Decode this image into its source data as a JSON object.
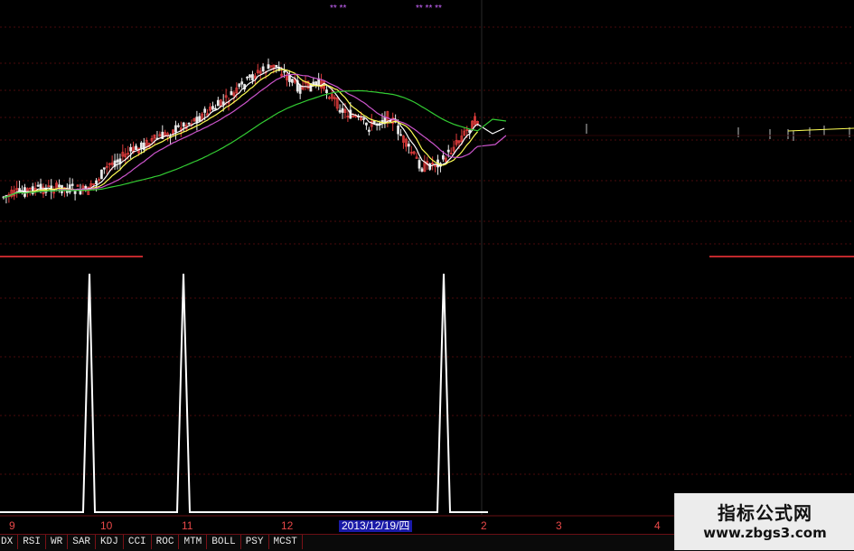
{
  "chart_data": [
    {
      "type": "candlestick",
      "panel": "price",
      "grid": true,
      "moving_averages": [
        {
          "color": "#ffffff"
        },
        {
          "color": "#ffff55"
        },
        {
          "color": "#cc55cc"
        },
        {
          "color": "#33cc33"
        }
      ]
    },
    {
      "type": "line",
      "panel": "indicator",
      "grid": true,
      "signal_indices": [
        31,
        64,
        157
      ],
      "line_color": "#ffffff"
    }
  ],
  "colors": {
    "background": "#000000",
    "grid": "#4a0a0c",
    "up_candle": "#e03c3c",
    "down_candle": "#e8e8e8",
    "ma5": "#ffffff",
    "ma10": "#ffff55",
    "ma20": "#cc55cc",
    "ma60": "#33cc33",
    "separator": "#c0282c",
    "axis_text": "#e84848"
  },
  "top_markers": {
    "left": "** **",
    "right": "** ** **"
  },
  "time_axis": {
    "labels": [
      "9",
      "10",
      "11",
      "12",
      "2",
      "3",
      "4"
    ],
    "crosshair_date": "2013/12/19/四"
  },
  "indicator_tabs": [
    "DX",
    "RSI",
    "WR",
    "SAR",
    "KDJ",
    "CCI",
    "ROC",
    "MTM",
    "BOLL",
    "PSY",
    "MCST"
  ],
  "watermark": {
    "title": "指标公式网",
    "url": "www.zbgs3.com"
  }
}
